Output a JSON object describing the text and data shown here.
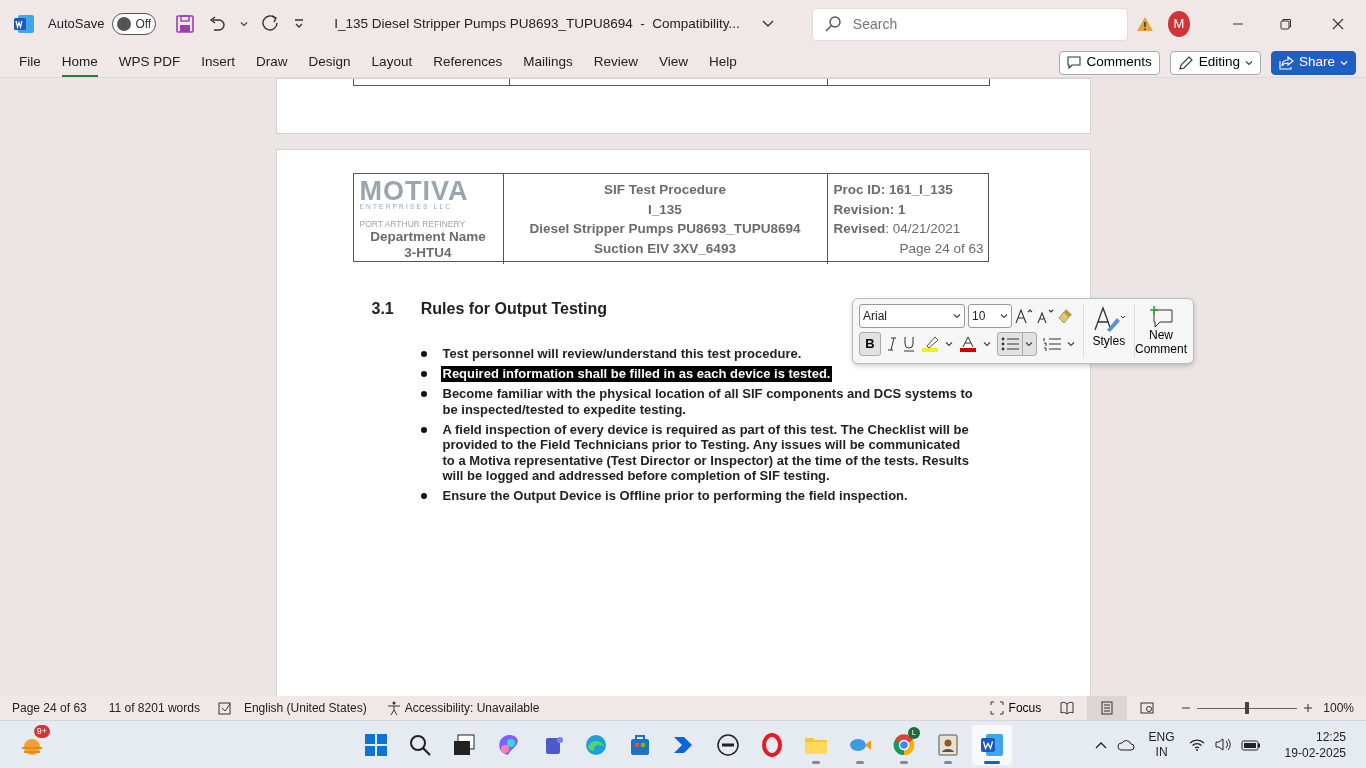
{
  "title_bar": {
    "autosave_label": "AutoSave",
    "autosave": {
      "on": false,
      "label": "Off"
    },
    "document_title": "I_135 Diesel Stripper Pumps PU8693_TUPU8694  -  Compatibility...",
    "search_placeholder": "Search",
    "avatar": "M"
  },
  "ribbon": {
    "tabs": [
      {
        "label": "File",
        "selected": false
      },
      {
        "label": "Home",
        "selected": true
      },
      {
        "label": "WPS PDF",
        "selected": false
      },
      {
        "label": "Insert",
        "selected": false
      },
      {
        "label": "Draw",
        "selected": false
      },
      {
        "label": "Design",
        "selected": false
      },
      {
        "label": "Layout",
        "selected": false
      },
      {
        "label": "References",
        "selected": false
      },
      {
        "label": "Mailings",
        "selected": false
      },
      {
        "label": "Review",
        "selected": false
      },
      {
        "label": "View",
        "selected": false
      },
      {
        "label": "Help",
        "selected": false
      }
    ],
    "comments": "Comments",
    "editing": "Editing",
    "share": "Share"
  },
  "document": {
    "header": {
      "logo": "MOTIVA",
      "logo_sub": "ENTERPRISES LLC",
      "refinery": "PORT ARTHUR REFINERY",
      "department": [
        "Department Name",
        "3-HTU4"
      ],
      "center": [
        "SIF Test Procedure",
        "I_135",
        "Diesel Stripper Pumps PU8693_TUPU8694",
        "Suction EIV 3XV_6493"
      ],
      "right": [
        "**Proc ID: 161_I_135**",
        "**Revision: 1**",
        "**Revised**: 04/21/2021"
      ],
      "page": "Page 24 of 63"
    },
    "section_number": "3.1",
    "section_title": "Rules for Output Testing",
    "bullets": [
      {
        "text": "Test personnel will review/understand this test procedure.",
        "selected": false
      },
      {
        "text": "Required information shall be filled in as each device is tested.",
        "selected": true
      },
      {
        "text": "Become familiar with the physical location of all SIF components and DCS systems to be inspected/tested to expedite testing.",
        "selected": false
      },
      {
        "text": "A field inspection of every device is required as part of this test. The Checklist will be provided to the Field Technicians prior to Testing. Any issues will be communicated to a Motiva representative (Test Director or Inspector) at the time of the tests. Results will be logged and addressed before completion of SIF testing.",
        "selected": false
      },
      {
        "text": "Ensure the Output Device is Offline prior to performing the field inspection.",
        "selected": false
      }
    ]
  },
  "mini_toolbar": {
    "font": "Arial",
    "size": "10",
    "bold_label": "B",
    "bold": true,
    "bullets_on": true,
    "styles": "Styles",
    "new_comment": "New Comment"
  },
  "status_bar": {
    "page": "Page 24 of 63",
    "words": "11 of 8201 words",
    "language": "English (United States)",
    "accessibility": "Accessibility: Unavailable",
    "focus": "Focus",
    "views": [
      {
        "kind": "read",
        "selected": false
      },
      {
        "kind": "print",
        "selected": true
      },
      {
        "kind": "web",
        "selected": false
      }
    ],
    "zoom": {
      "level": 0.5
    },
    "zoom_text": "100%"
  },
  "taskbar": {
    "widget_badge": "9+",
    "apps": [
      {
        "kind": "windows",
        "running": false
      },
      {
        "kind": "search",
        "running": false
      },
      {
        "kind": "taskview",
        "running": false
      },
      {
        "kind": "swirl",
        "running": false
      },
      {
        "kind": "people",
        "running": false
      },
      {
        "kind": "wave",
        "running": false
      },
      {
        "kind": "bag",
        "running": false
      },
      {
        "kind": "chevron",
        "running": false
      },
      {
        "kind": "disc",
        "running": false
      },
      {
        "kind": "ring",
        "running": false
      },
      {
        "kind": "folder",
        "running": true
      },
      {
        "kind": "fish",
        "running": true
      },
      {
        "kind": "globe",
        "running": true,
        "badge": "L"
      },
      {
        "kind": "card",
        "running": true
      },
      {
        "kind": "word",
        "running": true,
        "active": true
      }
    ],
    "lang": [
      "ENG",
      "IN"
    ],
    "time": "12:25",
    "date": "19-02-2025"
  }
}
